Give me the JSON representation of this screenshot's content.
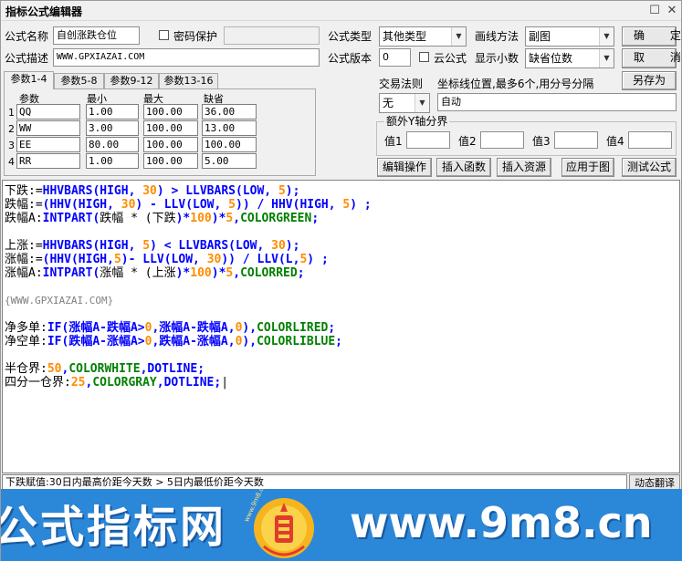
{
  "window": {
    "title": "指标公式编辑器"
  },
  "form": {
    "name_label": "公式名称",
    "name_value": "自创涨跌仓位",
    "password_label": "密码保护",
    "desc_label": "公式描述",
    "desc_value": "WWW.GPXIAZAI.COM",
    "type_label": "公式类型",
    "type_value": "其他类型",
    "draw_label": "画线方法",
    "draw_value": "副图",
    "version_label": "公式版本",
    "version_value": "0",
    "cloud_label": "云公式",
    "decimal_label": "显示小数",
    "decimal_value": "缺省位数",
    "trade_label": "交易法则",
    "trade_value": "无",
    "coord_label": "坐标线位置,最多6个,用分号分隔",
    "coord_value": "自动",
    "yaxis_group_label": "额外Y轴分界",
    "yaxis_labels": [
      "值1",
      "值2",
      "值3",
      "值4"
    ]
  },
  "buttons": {
    "ok": "确 定",
    "cancel": "取 消",
    "save_as": "另存为",
    "edit_op": "编辑操作",
    "insert_func": "插入函数",
    "insert_res": "插入资源",
    "apply_chart": "应用于图",
    "test": "测试公式",
    "animate": "动态翻译"
  },
  "tabs": [
    "参数1-4",
    "参数5-8",
    "参数9-12",
    "参数13-16"
  ],
  "params": {
    "headers": [
      "参数",
      "最小",
      "最大",
      "缺省"
    ],
    "rows": [
      {
        "idx": "1",
        "name": "QQ",
        "min": "1.00",
        "max": "100.00",
        "def": "36.00"
      },
      {
        "idx": "2",
        "name": "WW",
        "min": "3.00",
        "max": "100.00",
        "def": "13.00"
      },
      {
        "idx": "3",
        "name": "EE",
        "min": "80.00",
        "max": "100.00",
        "def": "100.00"
      },
      {
        "idx": "4",
        "name": "RR",
        "min": "1.00",
        "max": "100.00",
        "def": "5.00"
      }
    ]
  },
  "code": {
    "l1": {
      "a": "下跌:=",
      "b": "HHVBARS(HIGH, ",
      "c": "30",
      "d": ") > ",
      "e": "LLVBARS(LOW, ",
      "f": "5",
      "g": ");"
    },
    "l2": {
      "a": "跌幅:=",
      "b": "(HHV(HIGH, ",
      "c": "30",
      "d": ") - ",
      "e": "LLV(LOW, ",
      "f": "5",
      "g": ")) / ",
      "h": "HHV(HIGH, ",
      "i": "5",
      "j": ") ;"
    },
    "l3": {
      "a": "跌幅A:",
      "b": "INTPART(",
      "c": "跌幅 * (",
      "d": "下跌",
      "e": ")*",
      "f": "100",
      "g": ")*",
      "h": "5",
      "i": ",",
      "j": "COLORGREEN",
      "k": ";"
    },
    "l4": {
      "a": "上涨:=",
      "b": "HHVBARS(HIGH, ",
      "c": "5",
      "d": ") < ",
      "e": "LLVBARS(LOW, ",
      "f": "30",
      "g": ");"
    },
    "l5": {
      "a": "涨幅:=",
      "b": "(HHV(HIGH,",
      "c": "5",
      "d": ")- ",
      "e": "LLV(LOW, ",
      "f": "30",
      "g": ")) / ",
      "h": "LLV(L,",
      "i": "5",
      "j": ") ;"
    },
    "l6": {
      "a": "涨幅A:",
      "b": "INTPART(",
      "c": "涨幅 * (",
      "d": "上涨",
      "e": ")*",
      "f": "100",
      "g": ")*",
      "h": "5",
      "i": ",",
      "j": "COLORRED",
      "k": ";"
    },
    "l7": {
      "a": "{WWW.GPXIAZAI.COM}"
    },
    "l8": {
      "a": "净多单:",
      "b": "IF(",
      "c": "涨幅A-跌幅A>",
      "d": "0",
      "e": ",涨幅A-跌幅A,",
      "f": "0",
      "g": "),",
      "h": "COLORLIRED",
      "i": ";"
    },
    "l9": {
      "a": "净空单:",
      "b": "IF(",
      "c": "跌幅A-涨幅A>",
      "d": "0",
      "e": ",跌幅A-涨幅A,",
      "f": "0",
      "g": "),",
      "h": "COLORLIBLUE",
      "i": ";"
    },
    "l10": {
      "a": "半仓界:",
      "b": "50",
      "c": ",",
      "d": "COLORWHITE",
      "e": ",",
      "f": "DOTLINE",
      "g": ";"
    },
    "l11": {
      "a": "四分一仓界:",
      "b": "25",
      "c": ",",
      "d": "COLORGRAY",
      "e": ",",
      "f": "DOTLINE",
      "g": ";"
    }
  },
  "status": {
    "text": "下跌赋值:30日内最高价距今天数 > 5日内最低价距今天数"
  },
  "banner": {
    "left": "公式指标网",
    "right": "www.9m8.cn",
    "logo_small": "www.9m8.cn"
  },
  "colors": {
    "keyword": "#0000ff",
    "number": "#ff8c00",
    "color_const": "#008000",
    "banner_bg": "#2b87d8"
  }
}
